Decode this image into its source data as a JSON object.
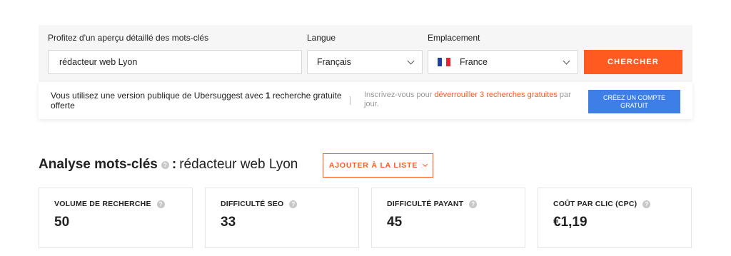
{
  "search": {
    "keyword_label": "Profitez d'un aperçu détaillé des mots-clés",
    "keyword_value": "rédacteur web Lyon",
    "language_label": "Langue",
    "language_value": "Français",
    "location_label": "Emplacement",
    "location_value": "France",
    "search_button": "CHERCHER",
    "flag_colors": [
      "#1f3fa3",
      "#ffffff",
      "#e3262f"
    ]
  },
  "notice": {
    "left_prefix": "Vous utilisez une version publique de Ubersuggest avec ",
    "left_count": "1",
    "left_suffix": " recherche gratuite offerte",
    "mid_prefix": "Inscrivez-vous pour ",
    "mid_highlight": "déverrouiller 3 recherches gratuites",
    "mid_suffix": " par jour.",
    "create_button": "CRÉEZ UN COMPTE GRATUIT"
  },
  "analysis": {
    "title_bold": "Analyse mots-clés",
    "title_sep": " : ",
    "keyword": "rédacteur web Lyon",
    "add_list_button": "AJOUTER À LA LISTE"
  },
  "metrics": [
    {
      "label": "VOLUME DE RECHERCHE",
      "value": "50"
    },
    {
      "label": "DIFFICULTÉ SEO",
      "value": "33"
    },
    {
      "label": "DIFFICULTÉ PAYANT",
      "value": "45"
    },
    {
      "label": "COÛT PAR CLIC (CPC)",
      "value": "€1,19"
    }
  ],
  "colors": {
    "accent": "#ff5a1f",
    "cta_blue": "#3d7fe6",
    "panel_bg": "#f5f6f5"
  },
  "icons": {
    "help": "question-circle-icon",
    "dropdown": "chevron-down-icon",
    "flag": "france-flag-icon"
  }
}
